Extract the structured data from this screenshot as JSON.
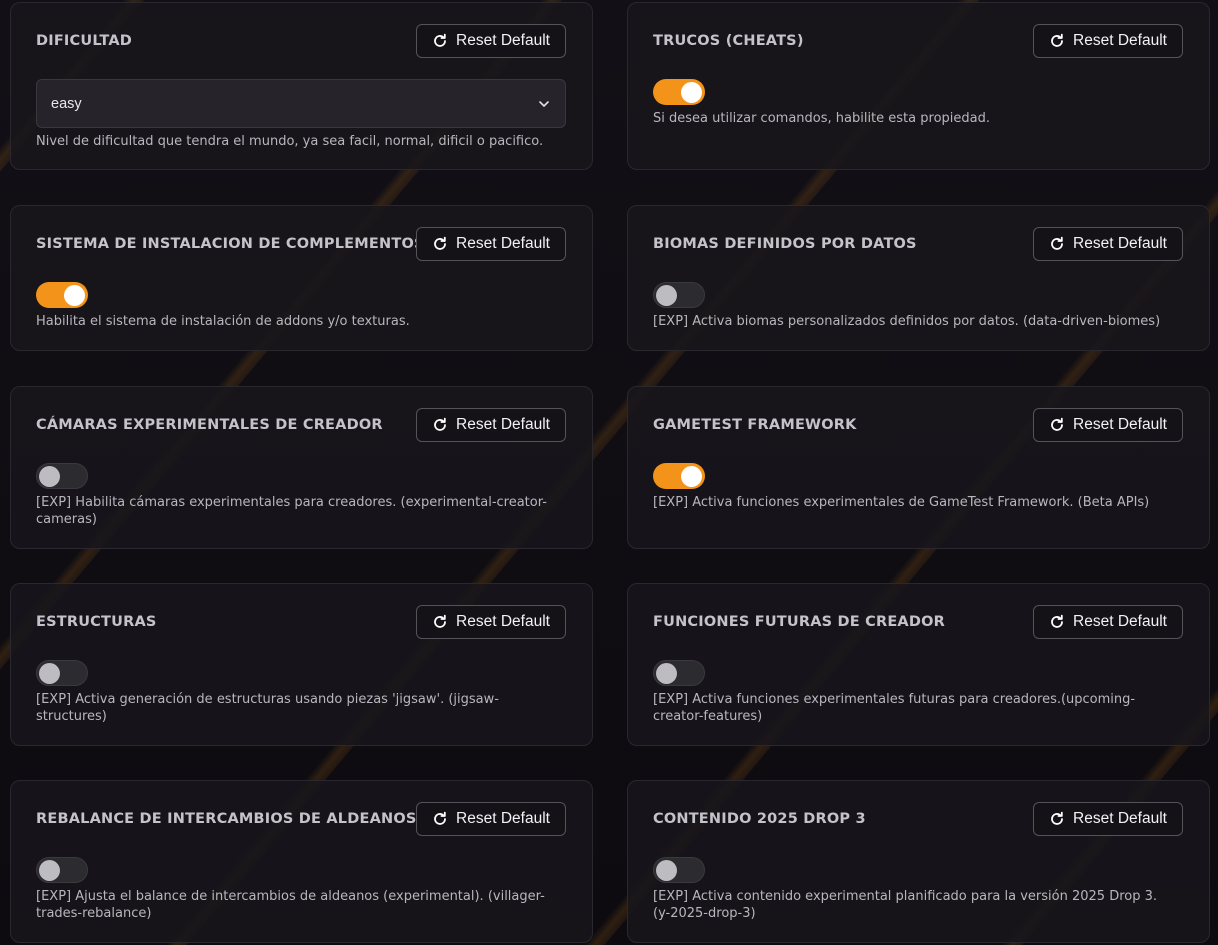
{
  "reset_label": "Reset Default",
  "colors": {
    "accent": "#f39319",
    "card_bg": "#18161b",
    "toggle_off": "#2c2b2f"
  },
  "settings": [
    {
      "title": "DIFICULTAD",
      "control": "select",
      "value": "easy",
      "description": "Nivel de dificultad que tendra el mundo, ya sea facil, normal, dificil o pacifico."
    },
    {
      "title": "TRUCOS (CHEATS)",
      "control": "toggle",
      "enabled": true,
      "description": "Si desea utilizar comandos, habilite esta propiedad."
    },
    {
      "title": "SISTEMA DE INSTALACION DE COMPLEMENTOS",
      "control": "toggle",
      "enabled": true,
      "description": "Habilita el sistema de instalación de addons y/o texturas."
    },
    {
      "title": "BIOMAS DEFINIDOS POR DATOS",
      "control": "toggle",
      "enabled": false,
      "description": "[EXP] Activa biomas personalizados definidos por datos. (data-driven-biomes)"
    },
    {
      "title": "CÁMARAS EXPERIMENTALES DE CREADOR",
      "control": "toggle",
      "enabled": false,
      "description": "[EXP] Habilita cámaras experimentales para creadores. (experimental-creator-cameras)"
    },
    {
      "title": "GAMETEST FRAMEWORK",
      "control": "toggle",
      "enabled": true,
      "description": "[EXP] Activa funciones experimentales de GameTest Framework. (Beta APIs)"
    },
    {
      "title": "ESTRUCTURAS",
      "control": "toggle",
      "enabled": false,
      "description": "[EXP] Activa generación de estructuras usando piezas 'jigsaw'. (jigsaw-structures)"
    },
    {
      "title": "FUNCIONES FUTURAS DE CREADOR",
      "control": "toggle",
      "enabled": false,
      "description": "[EXP] Activa funciones experimentales futuras para creadores.(upcoming-creator-features)"
    },
    {
      "title": "REBALANCE DE INTERCAMBIOS DE ALDEANOS",
      "control": "toggle",
      "enabled": false,
      "description": "[EXP] Ajusta el balance de intercambios de aldeanos (experimental). (villager-trades-rebalance)"
    },
    {
      "title": "CONTENIDO 2025 DROP 3",
      "control": "toggle",
      "enabled": false,
      "description": "[EXP] Activa contenido experimental planificado para la versión 2025 Drop 3.(y-2025-drop-3)"
    }
  ]
}
